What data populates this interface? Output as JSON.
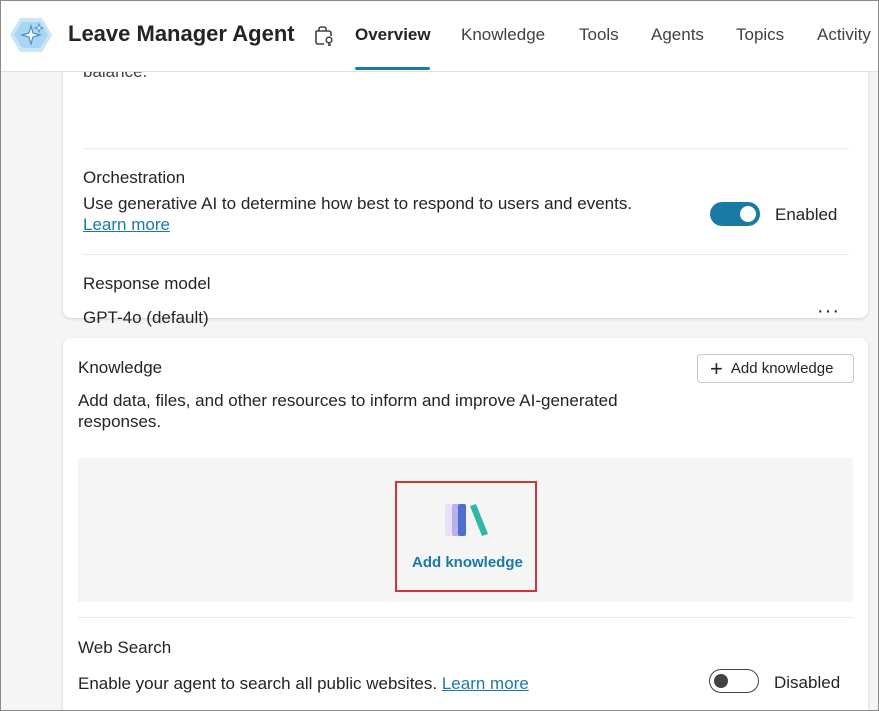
{
  "header": {
    "agent_name": "Leave Manager Agent",
    "tabs": [
      {
        "label": "Overview",
        "active": true
      },
      {
        "label": "Knowledge",
        "active": false
      },
      {
        "label": "Tools",
        "active": false
      },
      {
        "label": "Agents",
        "active": false
      },
      {
        "label": "Topics",
        "active": false
      },
      {
        "label": "Activity",
        "active": false
      }
    ]
  },
  "settings_card": {
    "clipped_text": "balance.",
    "orchestration": {
      "title": "Orchestration",
      "description": "Use generative AI to determine how best to respond to users and events.",
      "learn_more": "Learn more",
      "toggle_state": "on",
      "toggle_label": "Enabled"
    },
    "response_model": {
      "title": "Response model",
      "value": "GPT-4o (default)",
      "more_label": "···"
    }
  },
  "knowledge_card": {
    "title": "Knowledge",
    "add_button_label": "Add knowledge",
    "description_line1": "Add data, files, and other resources to inform and improve AI-generated",
    "description_line2": "responses.",
    "empty_state_link": "Add knowledge",
    "web_search": {
      "title": "Web Search",
      "description": "Enable your agent to search all public websites.",
      "learn_more": "Learn more",
      "toggle_state": "off",
      "toggle_label": "Disabled"
    }
  },
  "colors": {
    "accent": "#1a7aa6",
    "highlight": "#d13438"
  }
}
